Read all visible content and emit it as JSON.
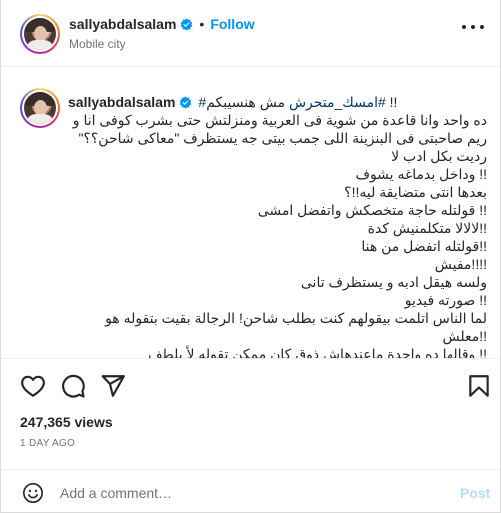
{
  "header": {
    "username": "sallyabdalsalam",
    "separator": "•",
    "follow_label": "Follow",
    "location": "Mobile city"
  },
  "caption": {
    "username": "sallyabdalsalam",
    "first_line_text": "!! ",
    "hashtag1": "#امسك_متحرش",
    "first_line_mid": " مش هنسيبكم",
    "hashtag2": "#",
    "lines": [
      "ده واحد وانا قاعدة من شوية فى العربية ومنزلتش حتى بشرب كوفى انا و",
      "ريم صاحبتى فى البنزينة اللى جمب بيتى جه يستظرف \"معاكى شاحن؟؟\"",
      "رديت بكل ادب لا",
      "!! وداخل بدماغه يشوف",
      "بعدها انتى متضايقة ليه!!؟",
      "!! قولتله حاجة متخصكش واتفضل امشى",
      "!!لالالا متكلمنيش كدة",
      "!!قولتله اتفضل من هنا",
      "!!!!مفيش",
      "ولسه هيقل ادبه و يستظرف تانى",
      "!! صورته فيديو",
      "لما الناس اتلمت بيقولهم كنت بطلب شاحن! الرجالة بقيت بتقوله هو",
      "!!معلش",
      "!! وقالها ده واحدة ماعندهاش ذوق كان ممكن تقوله لأ بلطف"
    ]
  },
  "actions": {
    "like_icon": "heart-icon",
    "comment_icon": "comment-icon",
    "share_icon": "share-icon",
    "save_icon": "bookmark-icon"
  },
  "stats": {
    "views": "247,365 views",
    "time_ago": "1 DAY AGO"
  },
  "comment_box": {
    "placeholder": "Add a comment…",
    "post_label": "Post"
  },
  "colors": {
    "accent": "#0095f6",
    "hashtag": "#00376b",
    "post_disabled": "#b2dffc",
    "secondary_text": "#737373"
  }
}
